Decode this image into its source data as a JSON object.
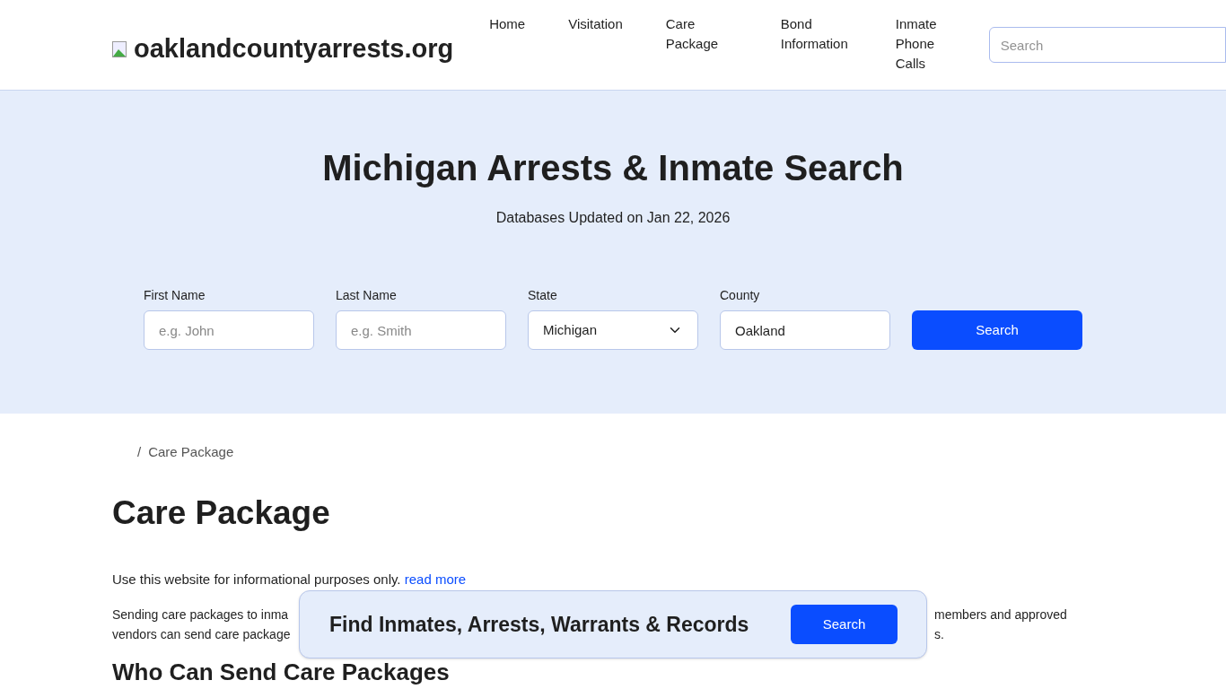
{
  "header": {
    "site_name": "oaklandcountyarrests.org",
    "nav": [
      {
        "label": "Home"
      },
      {
        "label": "Visitation"
      },
      {
        "label": "Care Package"
      },
      {
        "label": "Bond Information"
      },
      {
        "label": "Inmate Phone Calls"
      }
    ],
    "search": {
      "placeholder": "Search"
    }
  },
  "hero": {
    "title": "Michigan Arrests & Inmate Search",
    "subtitle": "Databases Updated on Jan 22, 2026",
    "fields": [
      {
        "kind": "input",
        "label": "First Name",
        "placeholder": "e.g. John"
      },
      {
        "kind": "input",
        "label": "Last Name",
        "placeholder": "e.g. Smith"
      },
      {
        "kind": "select",
        "label": "State",
        "value": "Michigan"
      },
      {
        "kind": "input",
        "label": "County",
        "value": "Oakland"
      }
    ],
    "button": "Search"
  },
  "breadcrumb": {
    "separator": "/",
    "current": "Care Package"
  },
  "page": {
    "title": "Care Package",
    "disclaimer": "Use this website for informational purposes only.",
    "disclaimer_link": "read more",
    "paragraph_lines": [
      {
        "left": "Sending care packages to inma",
        "right": "members and approved"
      },
      {
        "left": "vendors can send care package",
        "right": "s."
      }
    ],
    "heading": "Who Can Send Care Packages"
  },
  "banner": {
    "text": "Find Inmates, Arrests, Warrants & Records",
    "button": "Search"
  }
}
